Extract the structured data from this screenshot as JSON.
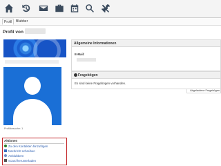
{
  "toolbar": {
    "icons": [
      "home-icon",
      "history-icon",
      "mail-icon",
      "briefcase-icon",
      "calendar-icon",
      "search-icon",
      "tools-icon"
    ]
  },
  "tabs": [
    {
      "label": "Profil",
      "active": true
    },
    {
      "label": "Blubber",
      "active": false
    }
  ],
  "page": {
    "title": "Profil von"
  },
  "avatar": {
    "caption": "Profilbesuche: 1"
  },
  "actions": {
    "title": "Aktionen",
    "items": [
      {
        "label": "Zu den Kontakten hinzufügen",
        "icon": "add-contact-icon",
        "color": "#2a7a2a"
      },
      {
        "label": "Nachricht schreiben",
        "icon": "mail-icon",
        "color": "#3a6fbf"
      },
      {
        "label": "Anblubbern",
        "icon": "blubber-icon",
        "color": "#6b8dc4"
      },
      {
        "label": "vCard herunterladen",
        "icon": "vcard-icon",
        "color": "#555555"
      }
    ]
  },
  "info_panel": {
    "title": "Allgemeine Informationen",
    "email_label": "E-Mail:"
  },
  "fb_panel": {
    "title": "Fragebögen",
    "text": "Es sind keine Fragebögen vorhanden."
  },
  "archived_button": "Abgelaufene Fragebögen",
  "colors": {
    "accent": "#1a6fd6",
    "highlight_border": "#c4282b",
    "link": "#2a5db0"
  }
}
